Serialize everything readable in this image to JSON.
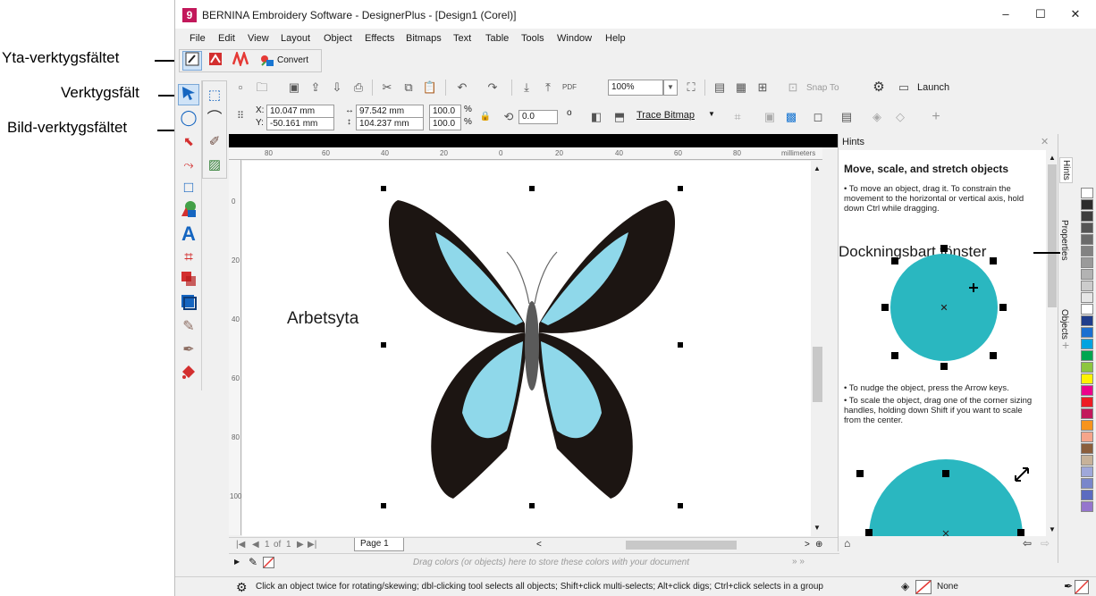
{
  "window": {
    "title": "BERNINA Embroidery Software - DesignerPlus - [Design1 (Corel)]",
    "logo_glyph": "9",
    "minimize": "–",
    "maximize": "☐",
    "close": "✕"
  },
  "menu": [
    "File",
    "Edit",
    "View",
    "Layout",
    "Object",
    "Effects",
    "Bitmaps",
    "Text",
    "Table",
    "Tools",
    "Window",
    "Help"
  ],
  "annotations": {
    "surface_toolbar": "Yta-verktygsfältet",
    "toolbox": "Verktygsfält",
    "bitmap_toolbar": "Bild-verktygsfältet",
    "workspace": "Arbetsyta",
    "docker": "Dockningsbart fönster"
  },
  "surface_toolbar": {
    "convert_label": "Convert"
  },
  "standard_toolbar": {
    "zoom": "100%",
    "snap_to": "Snap To",
    "launch": "Launch"
  },
  "property_bar": {
    "x": "10.047 mm",
    "y": "-50.161 mm",
    "x_label": "X:",
    "y_label": "Y:",
    "width": "97.542 mm",
    "height": "104.237 mm",
    "scale_w": "100.0",
    "scale_h": "100.0",
    "percent": "%",
    "rotation": "0.0",
    "degree": "o",
    "trace_bitmap": "Trace Bitmap"
  },
  "rulers": {
    "top_ticks": [
      "80",
      "60",
      "40",
      "20",
      "0",
      "20",
      "40",
      "60",
      "80"
    ],
    "unit": "millimeters",
    "left_ticks": [
      "0",
      "20",
      "40",
      "60",
      "80",
      "100"
    ]
  },
  "page_nav": {
    "counter": "1",
    "of": "of",
    "total": "1",
    "page_tab": "Page 1"
  },
  "color_bar_hint": "Drag colors (or objects) here to store these colors with your document",
  "status": {
    "message": "Click an object twice for rotating/skewing; dbl-clicking tool selects all objects; Shift+click multi-selects; Alt+click digs; Ctrl+click selects in a group",
    "fill": "None"
  },
  "hints": {
    "panel_title": "Hints",
    "heading": "Move, scale, and stretch objects",
    "p1_a": "• To move an object, drag it. To constrain the",
    "p1_b": "movement to the horizontal or vertical axis, hold",
    "p1_c": "down Ctrl while dragging.",
    "p2": "• To nudge the object, press the Arrow keys.",
    "p3_a": "• To scale the object, drag one of the corner sizing",
    "p3_b": "handles, holding down Shift if you want to scale",
    "p3_c": "from the center.",
    "circle_color": "#2ab7c0"
  },
  "dock_tabs": [
    "Hints",
    "Properties",
    "Objects"
  ],
  "palette_colors": [
    "#ffffff",
    "#2b2b2b",
    "#3d3d3d",
    "#555555",
    "#6b6b6b",
    "#828282",
    "#9a9a9a",
    "#b3b3b3",
    "#cccccc",
    "#e6e6e6",
    "#ffffff",
    "#1f3d8c",
    "#1a6fd1",
    "#00a3e0",
    "#00a651",
    "#8dc63f",
    "#fff200",
    "#ec008c",
    "#ed1c24",
    "#c2185b",
    "#f7941d",
    "#f5a58b",
    "#8b5e3c",
    "#c7b299",
    "#9fa8da",
    "#7986cb",
    "#5c6bc0",
    "#9575cd"
  ]
}
